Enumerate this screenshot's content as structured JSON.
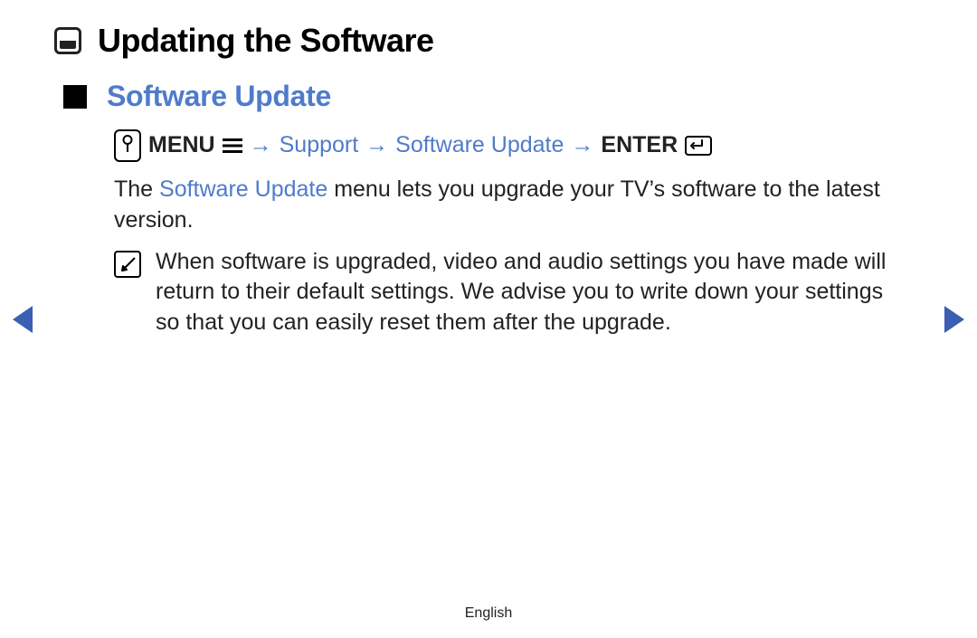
{
  "page_title": "Updating the Software",
  "section_title": "Software Update",
  "nav_path": {
    "menu_label": "MENU",
    "support_label": "Support",
    "software_update_label": "Software Update",
    "enter_label": "ENTER",
    "arrow_glyph": "→"
  },
  "description": {
    "prefix": "The ",
    "term": "Software Update",
    "suffix": " menu lets you upgrade your TV’s software to the latest version."
  },
  "note_text": "When software is upgraded, video and audio settings you have made will return to their default settings. We advise you to write down your settings so that you can easily reset them after the upgrade.",
  "footer_language": "English"
}
